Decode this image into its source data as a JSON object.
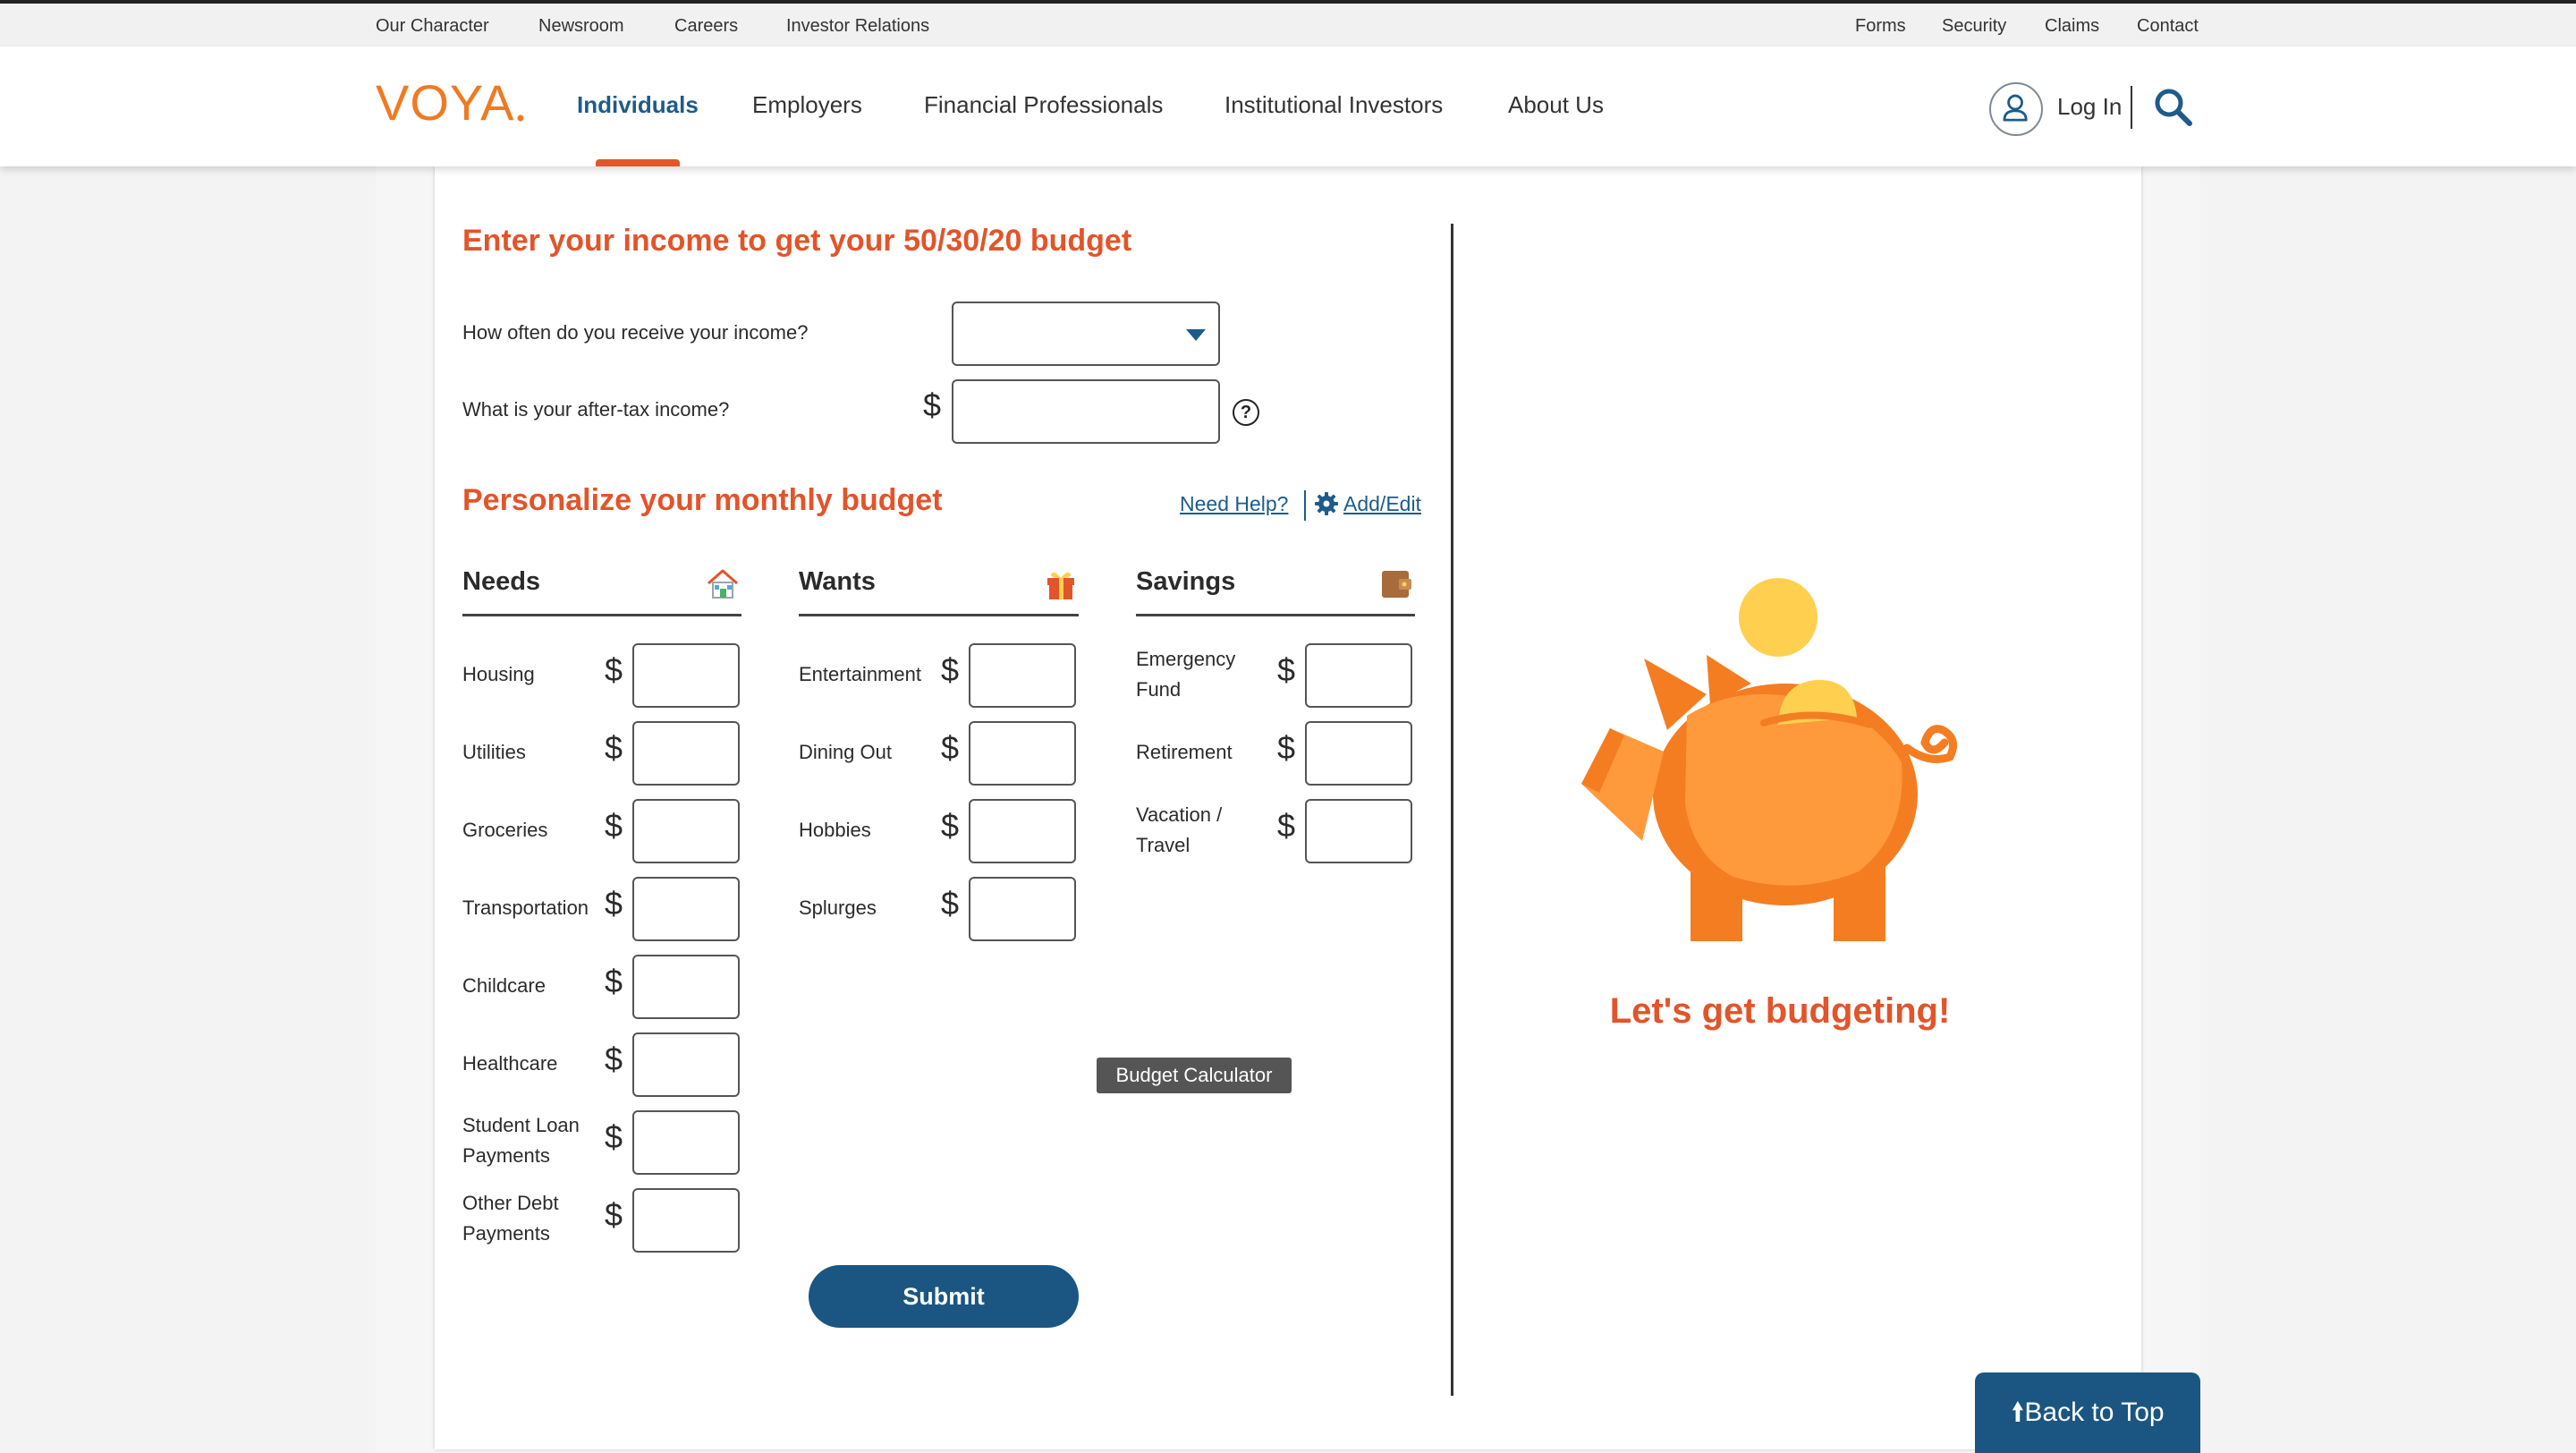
{
  "utility_nav": {
    "left": [
      "Our Character",
      "Newsroom",
      "Careers",
      "Investor Relations"
    ],
    "right": [
      "Forms",
      "Security",
      "Claims",
      "Contact"
    ]
  },
  "header": {
    "brand": "VOYA",
    "nav": [
      "Individuals",
      "Employers",
      "Financial Professionals",
      "Institutional Investors",
      "About Us"
    ],
    "active_nav": "Individuals",
    "login_label": "Log In"
  },
  "calculator": {
    "income_heading": "Enter your income to get your 50/30/20 budget",
    "frequency_question": "How often do you receive your income?",
    "frequency_selected": "",
    "aftertax_question": "What is your after-tax income?",
    "currency": "$",
    "help_glyph": "?",
    "personalize_heading": "Personalize your monthly budget",
    "need_help_link": "Need Help?",
    "add_edit_link": "Add/Edit",
    "columns": {
      "needs": {
        "title": "Needs",
        "icon": "house-icon",
        "items": [
          "Housing",
          "Utilities",
          "Groceries",
          "Transportation",
          "Childcare",
          "Healthcare",
          "Student Loan Payments",
          "Other Debt Payments"
        ]
      },
      "wants": {
        "title": "Wants",
        "icon": "gift-icon",
        "items": [
          "Entertainment",
          "Dining Out",
          "Hobbies",
          "Splurges"
        ]
      },
      "savings": {
        "title": "Savings",
        "icon": "wallet-icon",
        "items": [
          "Emergency Fund",
          "Retirement",
          "Vacation / Travel"
        ]
      }
    },
    "tooltip": "Budget Calculator",
    "submit_label": "Submit",
    "result_tagline": "Let's get budgeting!"
  },
  "back_to_top": "Back to Top",
  "colors": {
    "accent_orange": "#e2542a",
    "brand_blue": "#1a5681",
    "piggy_orange": "#ff9a3c",
    "coin_yellow": "#ffd04f"
  }
}
